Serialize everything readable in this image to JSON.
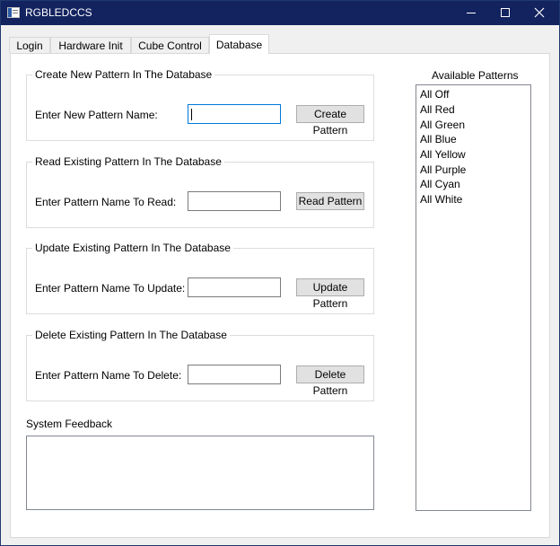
{
  "window": {
    "title": "RGBLEDCCS"
  },
  "tabs": [
    {
      "label": "Login"
    },
    {
      "label": "Hardware Init"
    },
    {
      "label": "Cube Control"
    },
    {
      "label": "Database"
    }
  ],
  "create": {
    "group_title": "Create New Pattern In The Database",
    "label": "Enter New Pattern Name:",
    "value": "",
    "button": "Create Pattern"
  },
  "read": {
    "group_title": "Read Existing Pattern In The Database",
    "label": "Enter Pattern Name To Read:",
    "value": "",
    "button": "Read Pattern"
  },
  "update": {
    "group_title": "Update Existing Pattern In The Database",
    "label": "Enter Pattern Name To Update:",
    "value": "",
    "button": "Update Pattern"
  },
  "delete": {
    "group_title": "Delete Existing Pattern In The Database",
    "label": "Enter Pattern Name To Delete:",
    "value": "",
    "button": "Delete Pattern"
  },
  "feedback": {
    "label": "System Feedback",
    "text": ""
  },
  "patterns": {
    "label": "Available Patterns",
    "items": [
      "All Off",
      "All Red",
      "All Green",
      "All Blue",
      "All Yellow",
      "All Purple",
      "All Cyan",
      "All White"
    ]
  },
  "colors": {
    "titlebar": "#13235f",
    "accent": "#0078d7"
  },
  "icons": {
    "app": "app-window-icon",
    "minimize": "minimize-icon",
    "maximize": "maximize-icon",
    "close": "close-icon"
  }
}
